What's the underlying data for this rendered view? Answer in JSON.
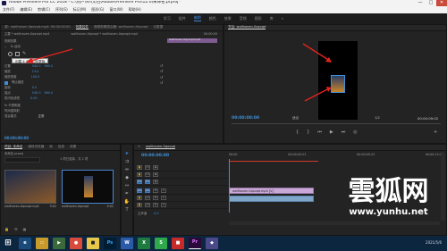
{
  "window": {
    "title": "Adobe Premiere Pro CC 2018 - C:\\用户\\xh\\文档\\Adobe\\Premiere Pro\\12.0\\未命名.prproj *",
    "minimize": "—",
    "maximize": "□",
    "close": "✕"
  },
  "menu": [
    "文件(F)",
    "编辑(E)",
    "剪辑(C)",
    "序列(S)",
    "标记(M)",
    "图形(G)",
    "窗口(W)",
    "帮助(H)"
  ],
  "workspaces": {
    "items": [
      "学习",
      "组件",
      "编辑",
      "颜色",
      "效果",
      "音频",
      "图形",
      "库"
    ],
    "active": "编辑",
    "more": "»"
  },
  "source_panel": {
    "tabs": [
      "源：wallhaven-0qxvqd.mp4: 00:00:00:00",
      "效果控件",
      "音频剪辑混合器: wallhaven-0qxvqd",
      "元数据"
    ],
    "active_tab": "效果控件",
    "header_source": "主要 * wallhaven-0qxvqd.mp4",
    "header_clip": "wallhaven-0qxvqd * wallhaven-0qxvqd.mp4",
    "header_timecode": "00:00:00",
    "clip_name": "wallhaven-0qxvqd.mp4",
    "section_video": "视频效果",
    "motion": "fx 运动",
    "tooltip": "创建 4 点多边形蒙版",
    "position_label": "位置",
    "position_x": "540.0",
    "position_y": "960.0",
    "scale_label": "缩放",
    "scale_value": "13.0",
    "scale_width_label": "缩放宽度",
    "scale_width_value": "100.0",
    "uniform_label": "等比缩放",
    "rotation_label": "旋转",
    "rotation_value": "0.0",
    "anchor_label": "锚点",
    "anchor_x": "540.0",
    "anchor_y": "960.0",
    "flicker_label": "防闪烁滤镜",
    "flicker_value": "0.00",
    "opacity_label": "fx 不透明度",
    "timewarp_label": "时间重映射",
    "blend_label": "混合模式",
    "blend_value": "正常",
    "footer_timecode": "00:00:00:00"
  },
  "program_panel": {
    "tab": "节目: wallhaven-0qxvqd",
    "timecode": "00:00:00:00",
    "fit": "适合",
    "quality": "1/2",
    "duration": "00:00:09:02"
  },
  "project_panel": {
    "tabs": [
      "项目: 未命名",
      "媒体浏览器",
      "库",
      "信息",
      "效果"
    ],
    "project_file": "未命名.prproj",
    "item_count": "1 项已选择，共 2 项",
    "items": [
      {
        "name": "wallhaven-0qxvqd.mp4",
        "duration": "9:02"
      },
      {
        "name": "wallhaven-0qxvqd",
        "duration": "9:02"
      }
    ]
  },
  "timeline": {
    "tab": "wallhaven-0qxvqd",
    "timecode": "00:00:00:00",
    "ruler": [
      "00:00",
      "00:00:04:23",
      "00:00:09:23",
      "00:00:14:23"
    ],
    "video_tracks": [
      "V3",
      "V2",
      "V1"
    ],
    "audio_tracks": [
      "A1",
      "A2",
      "A3"
    ],
    "master_label": "主声道",
    "master_value": "0.0",
    "clip_video": "wallhaven-0qxvqd.mp4 [V]",
    "clip_audio": ""
  },
  "watermark": {
    "title": "雲狐网",
    "url": "www.yunhu.net"
  },
  "taskbar": {
    "apps": [
      {
        "name": "Windows",
        "label": "⊞",
        "color": "#0d2640"
      },
      {
        "name": "Photoshop",
        "label": "Ps",
        "color": "#001d34"
      },
      {
        "name": "Premiere",
        "label": "Pr",
        "color": "#2a0a3a"
      }
    ],
    "clock": "2021/5/6"
  },
  "colors": {
    "accent": "#3e86d8",
    "timecode": "#3f8fd6",
    "annotation": "#e0241d",
    "playhead": "#3f8fd6",
    "clip_video": "#c9a8d8",
    "clip_audio": "#7fa6c8"
  }
}
